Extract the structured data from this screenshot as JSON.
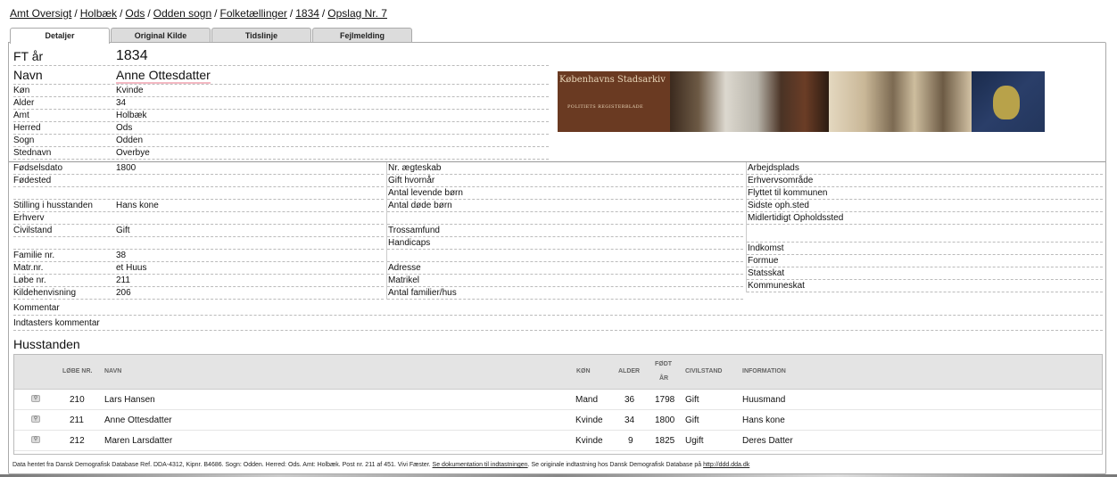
{
  "breadcrumb": {
    "items": [
      "Amt Oversigt",
      "Holbæk",
      "Ods",
      "Odden sogn",
      "Folketællinger",
      "1834",
      "Opslag Nr. 7"
    ],
    "separator": "/"
  },
  "tabs": [
    "Detaljer",
    "Original Kilde",
    "Tidslinje",
    "Fejlmelding"
  ],
  "details": {
    "ft_aar_label": "FT år",
    "ft_aar_value": "1834",
    "navn_label": "Navn",
    "navn_value": "Anne Ottesdatter",
    "koen_label": "Køn",
    "koen_value": "Kvinde",
    "alder_label": "Alder",
    "alder_value": "34",
    "amt_label": "Amt",
    "amt_value": "Holbæk",
    "herred_label": "Herred",
    "herred_value": "Ods",
    "sogn_label": "Sogn",
    "sogn_value": "Odden",
    "stednavn_label": "Stednavn",
    "stednavn_value": "Overbye"
  },
  "banner": {
    "title": "Københavns Stadsarkiv",
    "subtitle": "POLITIETS REGISTERBLADE"
  },
  "col1": [
    {
      "label": "Fødselsdato",
      "value": "1800"
    },
    {
      "label": "Fødested",
      "value": ""
    },
    {
      "label": "",
      "value": ""
    },
    {
      "label": "Stilling i husstanden",
      "value": "Hans kone"
    },
    {
      "label": "Erhverv",
      "value": ""
    },
    {
      "label": "Civilstand",
      "value": "Gift"
    },
    {
      "label": "",
      "value": ""
    },
    {
      "label": "Familie nr.",
      "value": "38"
    },
    {
      "label": "Matr.nr.",
      "value": "et Huus"
    },
    {
      "label": "Løbe nr.",
      "value": "211"
    },
    {
      "label": "Kildehenvisning",
      "value": "206"
    }
  ],
  "col2": [
    "Nr. ægteskab",
    "Gift hvornår",
    "Antal levende børn",
    "Antal døde børn",
    "",
    "Trossamfund",
    "Handicaps",
    "",
    "Adresse",
    "Matrikel",
    "Antal familier/hus"
  ],
  "col3": [
    "Arbejdsplads",
    "Erhvervsområde",
    "Flyttet til kommunen",
    "Sidste oph.sted",
    "Midlertidigt Opholdssted",
    "",
    "Indkomst",
    "Formue",
    "Statsskat",
    "Kommuneskat"
  ],
  "kommentar_label": "Kommentar",
  "indtasters_kommentar_label": "Indtasters kommentar",
  "husstanden": {
    "title": "Husstanden",
    "headers": {
      "loebe_nr": "LØBE NR.",
      "navn": "NAVN",
      "koen": "KØN",
      "alder": "ALDER",
      "foedt_aar_1": "FØDT",
      "foedt_aar_2": "ÅR",
      "civilstand": "CIVILSTAND",
      "information": "INFORMATION"
    },
    "rows": [
      {
        "loebe_nr": "210",
        "navn": "Lars Hansen",
        "koen": "Mand",
        "alder": "36",
        "foedt": "1798",
        "civilstand": "Gift",
        "information": "Huusmand"
      },
      {
        "loebe_nr": "211",
        "navn": "Anne Ottesdatter",
        "koen": "Kvinde",
        "alder": "34",
        "foedt": "1800",
        "civilstand": "Gift",
        "information": "Hans kone"
      },
      {
        "loebe_nr": "212",
        "navn": "Maren Larsdatter",
        "koen": "Kvinde",
        "alder": "9",
        "foedt": "1825",
        "civilstand": "Ugift",
        "information": "Deres Datter"
      }
    ]
  },
  "footer": {
    "text1": "Data hentet fra Dansk Demografisk Database Ref. DDA-4312, Kipnr. B4686. Sogn: Odden. Herred: Ods. Amt: Holbæk. Post nr. 211 af 451. Vivi Fæster.",
    "link1": "Se dokumentation til indtastningen",
    "text2": ". Se originale indtastning hos Dansk Demografisk Database på",
    "link2": "http://ddd.dda.dk"
  }
}
